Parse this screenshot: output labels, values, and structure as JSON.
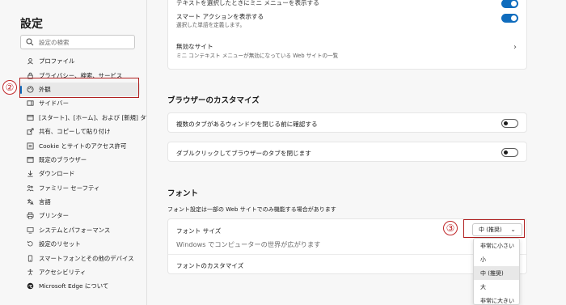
{
  "sidebar": {
    "title": "設定",
    "search_placeholder": "設定の検索",
    "items": [
      {
        "label": "プロファイル",
        "icon": "profile-icon"
      },
      {
        "label": "プライバシー、検索、サービス",
        "icon": "lock-icon"
      },
      {
        "label": "外観",
        "icon": "palette-icon"
      },
      {
        "label": "サイドバー",
        "icon": "sidebar-icon"
      },
      {
        "label": "[スタート]、[ホーム]、および [新規] タブ",
        "icon": "home-tab-icon"
      },
      {
        "label": "共有、コピーして貼り付け",
        "icon": "share-icon"
      },
      {
        "label": "Cookie とサイトのアクセス許可",
        "icon": "permissions-icon"
      },
      {
        "label": "既定のブラウザー",
        "icon": "browser-icon"
      },
      {
        "label": "ダウンロード",
        "icon": "download-icon"
      },
      {
        "label": "ファミリー セーフティ",
        "icon": "family-icon"
      },
      {
        "label": "言語",
        "icon": "language-icon"
      },
      {
        "label": "プリンター",
        "icon": "printer-icon"
      },
      {
        "label": "システムとパフォーマンス",
        "icon": "system-icon"
      },
      {
        "label": "設定のリセット",
        "icon": "reset-icon"
      },
      {
        "label": "スマートフォンとその他のデバイス",
        "icon": "phone-icon"
      },
      {
        "label": "アクセシビリティ",
        "icon": "accessibility-icon"
      },
      {
        "label": "Microsoft Edge について",
        "icon": "edge-icon"
      }
    ],
    "active_index": 2
  },
  "callouts": {
    "step2": "②",
    "step3": "③"
  },
  "top_card": {
    "row1_title": "テキストを選択したときにミニ メニューを表示する",
    "row2_title": "スマート アクションを表示する",
    "row2_sub": "選択した単語を定義します。",
    "row3_title": "無効なサイト",
    "row3_sub": "ミニ コンテキスト メニューが無効になっている Web サイトの一覧"
  },
  "browser_customize": {
    "heading": "ブラウザーのカスタマイズ",
    "row1": "複数のタブがあるウィンドウを閉じる前に確認する",
    "row2": "ダブルクリックしてブラウザーのタブを閉じます"
  },
  "fonts": {
    "heading": "フォント",
    "description": "フォント設定は一部の Web サイトでのみ機能する場合があります",
    "font_size_label": "フォント サイズ",
    "font_preview": "Windows でコンピューターの世界が広がります",
    "font_customize_label": "フォントのカスタマイズ",
    "selected_size": "中 (推奨)",
    "size_options": [
      "非常に小さい",
      "小",
      "中 (推奨)",
      "大",
      "非常に大きい"
    ]
  },
  "colors": {
    "accent": "#0f6cbd",
    "callout_red": "#c0282a"
  }
}
